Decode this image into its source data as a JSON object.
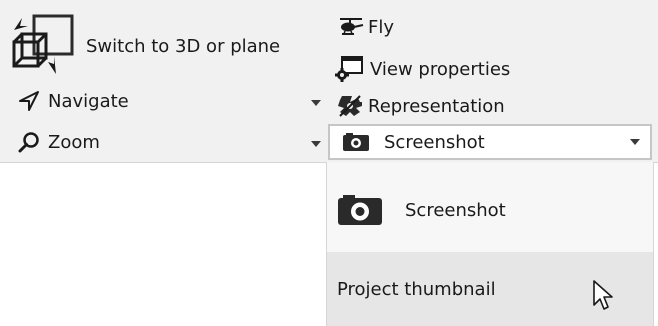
{
  "ribbon": {
    "switch_view": {
      "label": "Switch to 3D or plane",
      "icon": "switch-3d-plane-icon"
    },
    "navigate": {
      "label": "Navigate",
      "icon": "navigate-arrow-icon"
    },
    "zoom": {
      "label": "Zoom",
      "icon": "zoom-magnifier-icon"
    },
    "fly": {
      "label": "Fly",
      "icon": "helicopter-icon"
    },
    "view_properties": {
      "label": "View properties",
      "icon": "view-properties-icon"
    },
    "representation": {
      "label": "Representation",
      "icon": "representation-icon"
    },
    "screenshot_combo": {
      "selected": "Screenshot",
      "icon": "camera-icon"
    }
  },
  "screenshot_menu": {
    "items": [
      {
        "label": "Screenshot",
        "icon": "camera-icon"
      },
      {
        "label": "Project thumbnail"
      }
    ]
  },
  "colors": {
    "ribbon_bg": "#f1f1f1",
    "menu_bg": "#f7f7f7",
    "menu_hover": "#e6e6e6"
  }
}
